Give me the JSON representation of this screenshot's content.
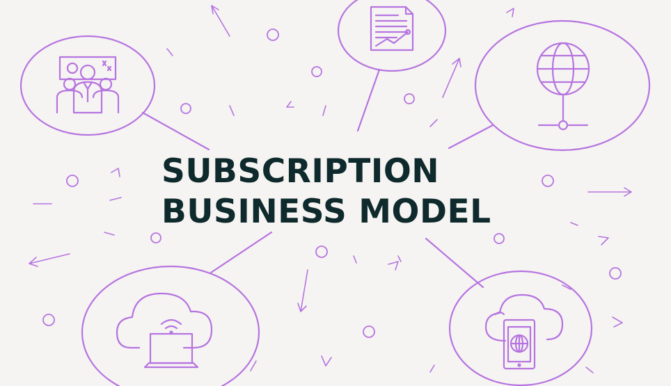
{
  "title": {
    "line1": "SUBSCRIPTION",
    "line2": "BUSINESS MODEL"
  },
  "colors": {
    "background": "#f5f4f2",
    "accent": "#b673e0",
    "text": "#0f2a2c"
  },
  "icons": [
    "team-money-icon",
    "document-chart-icon",
    "globe-network-icon",
    "cloud-laptop-wifi-icon",
    "cloud-mobile-globe-icon"
  ]
}
